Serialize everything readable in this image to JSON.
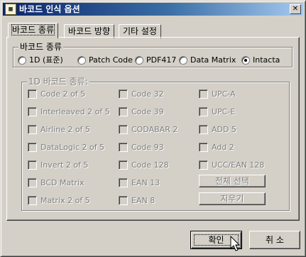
{
  "window": {
    "title": "바코드 인식 옵션",
    "icon": "app-icon",
    "close_label": "✕"
  },
  "tabs": [
    {
      "label": "바코드 종류",
      "active": true
    },
    {
      "label": "바코드 방향",
      "active": false
    },
    {
      "label": "기타 설정",
      "active": false
    }
  ],
  "barcode_type_group": {
    "label": "바코드 종류",
    "options": [
      {
        "label": "1D (표준)",
        "checked": false
      },
      {
        "label": "Patch Code",
        "checked": false
      },
      {
        "label": "PDF417",
        "checked": false
      },
      {
        "label": "Data Matrix",
        "checked": false
      },
      {
        "label": "Intacta",
        "checked": true
      }
    ]
  },
  "barcode_1d_group": {
    "label": "1D 바코드 종류:",
    "col1": [
      "Code 2 of 5",
      "Interleaved 2 of 5",
      "Airline 2 of 5",
      "DataLogic 2 of 5",
      "Invert 2 of 5",
      "BCD Matrix",
      "Matrix 2 of 5"
    ],
    "col2": [
      "Code 32",
      "Code 39",
      "CODABAR 2",
      "Code 93",
      "Code 128",
      "EAN 13",
      "EAN 8"
    ],
    "col3": [
      "UPC-A",
      "UPC-E",
      "ADD 5",
      "Add 2",
      "UCC/EAN 128"
    ],
    "select_all_label": "전체 선택",
    "clear_label": "지우기"
  },
  "footer": {
    "ok_label": "확인",
    "cancel_label": "취 소"
  }
}
